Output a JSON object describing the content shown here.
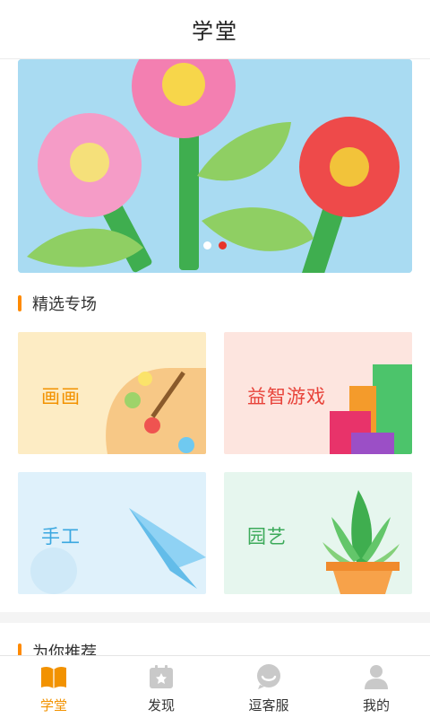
{
  "header": {
    "title": "学堂"
  },
  "banner": {
    "slide_count": 2,
    "active_slide": 2
  },
  "featured": {
    "title": "精选专场",
    "cards": [
      {
        "label": "画画",
        "label_color": "#f29200",
        "bg": "#fdecc4"
      },
      {
        "label": "益智游戏",
        "label_color": "#e8433a",
        "bg": "#fde5df"
      },
      {
        "label": "手工",
        "label_color": "#3aa7e0",
        "bg": "#dff1fb"
      },
      {
        "label": "园艺",
        "label_color": "#3caa5a",
        "bg": "#e6f6ee"
      }
    ]
  },
  "recommend": {
    "title": "为你推荐"
  },
  "tabbar": {
    "items": [
      {
        "label": "学堂",
        "icon": "book-icon",
        "active": true
      },
      {
        "label": "发现",
        "icon": "calendar-star-icon",
        "active": false
      },
      {
        "label": "逗客服",
        "icon": "chat-bubble-icon",
        "active": false
      },
      {
        "label": "我的",
        "icon": "user-icon",
        "active": false
      }
    ]
  },
  "colors": {
    "accent": "#f29200",
    "section_bar": "#ff8a00",
    "inactive_icon": "#c9c9c9"
  }
}
